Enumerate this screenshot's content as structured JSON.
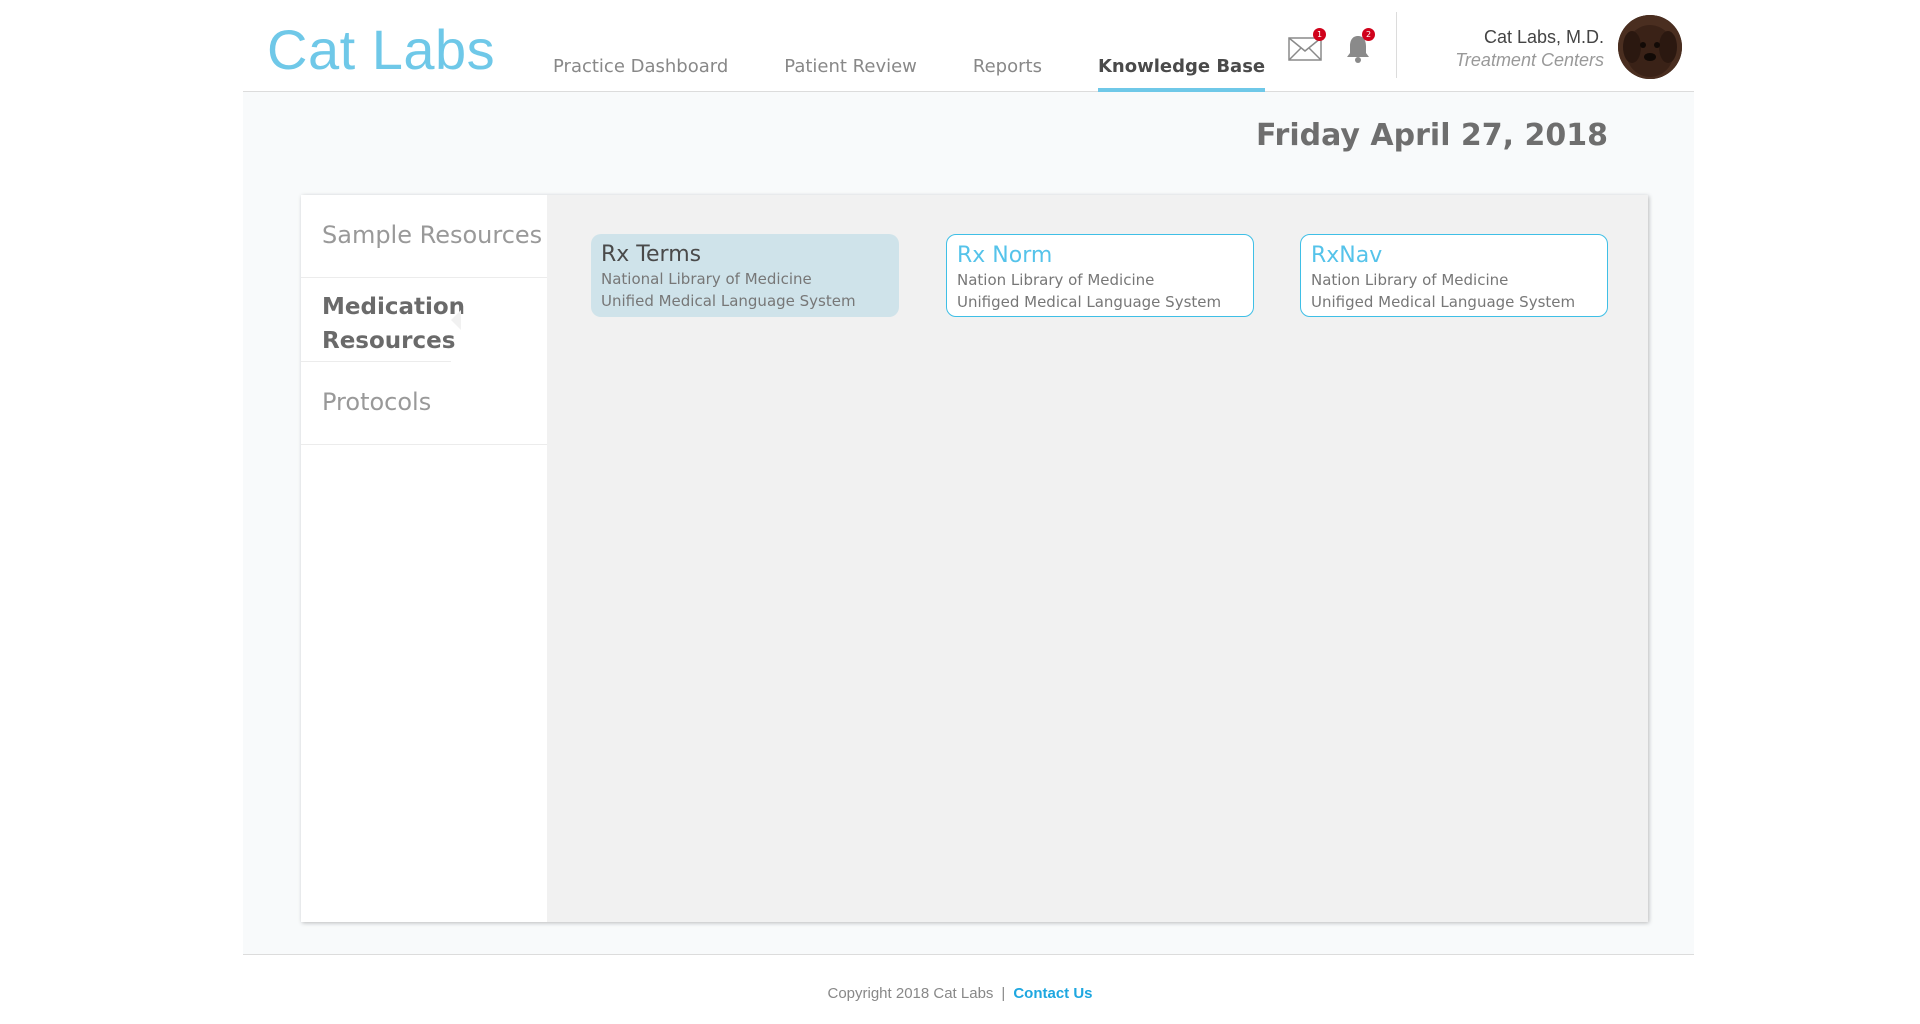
{
  "brand": {
    "logo": "Cat Labs"
  },
  "nav": {
    "items": [
      {
        "label": "Practice Dashboard"
      },
      {
        "label": "Patient Review"
      },
      {
        "label": "Reports"
      },
      {
        "label": "Knowledge Base"
      }
    ],
    "active": "Knowledge Base"
  },
  "notifications": {
    "mail_count": "1",
    "alert_count": "2",
    "mail_icon": "mail-icon",
    "bell_icon": "bell-icon"
  },
  "user": {
    "name": "Cat Labs, M.D.",
    "subtitle": "Treatment Centers"
  },
  "date": "Friday April 27, 2018",
  "sidebar": {
    "items": [
      {
        "label": "Sample Resources"
      },
      {
        "label": "Medication Resources"
      },
      {
        "label": "Protocols"
      }
    ],
    "active": "Medication Resources"
  },
  "cards": [
    {
      "title": "Rx Terms",
      "line1": "National Library of Medicine",
      "line2": "Unified Medical Language System"
    },
    {
      "title": "Rx Norm",
      "line1": "Nation Library of Medicine",
      "line2": "Unifiged Medical Language System"
    },
    {
      "title": "RxNav",
      "line1": "Nation Library of Medicine",
      "line2": "Unifiged Medical Language System"
    }
  ],
  "footer": {
    "copyright": "Copyright 2018 Cat Labs",
    "separator": "|",
    "contact": "Contact Us"
  },
  "colors": {
    "accent": "#6fc8e8",
    "badge": "#d0021b",
    "link": "#1ea7e0",
    "selected_card": "#cfe3ea"
  }
}
